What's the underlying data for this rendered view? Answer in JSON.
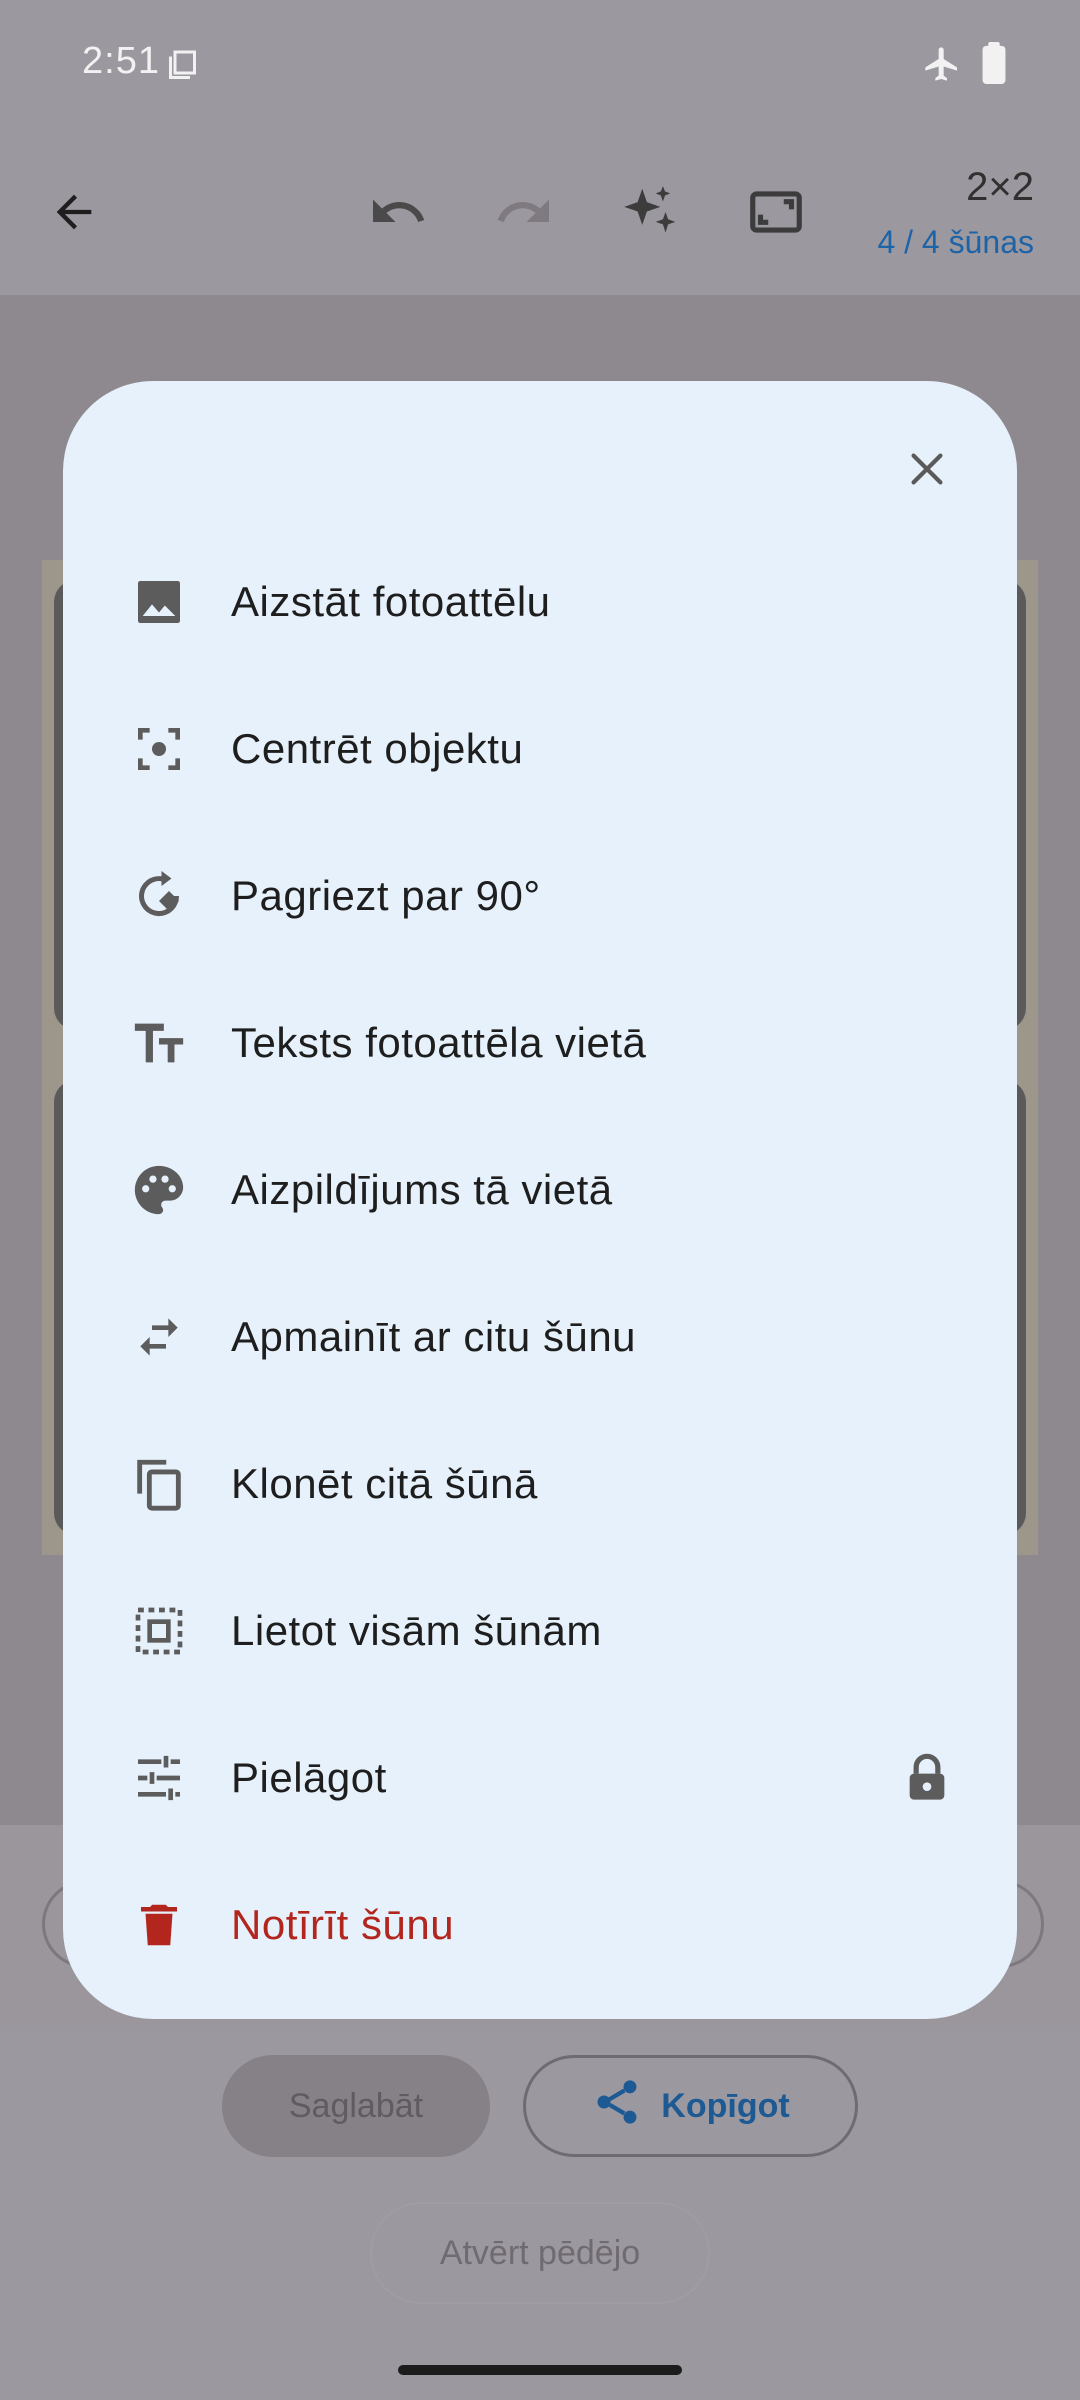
{
  "status_bar": {
    "time": "2:51"
  },
  "toolbar": {
    "grid_label": "2×2",
    "cell_count": "4 / 4 šūnas"
  },
  "dialog": {
    "items": [
      {
        "label": "Aizstāt fotoattēlu",
        "icon": "image-icon"
      },
      {
        "label": "Centrēt objektu",
        "icon": "center-focus-icon"
      },
      {
        "label": "Pagriezt par 90°",
        "icon": "rotate-icon"
      },
      {
        "label": "Teksts fotoattēla vietā",
        "icon": "text-fields-icon"
      },
      {
        "label": "Aizpildījums tā vietā",
        "icon": "palette-icon"
      },
      {
        "label": "Apmainīt ar citu šūnu",
        "icon": "swap-arrows-icon"
      },
      {
        "label": "Klonēt citā šūnā",
        "icon": "copy-icon"
      },
      {
        "label": "Lietot visām šūnām",
        "icon": "select-all-icon"
      },
      {
        "label": "Pielāgot",
        "icon": "tune-icon",
        "locked": true
      },
      {
        "label": "Notīrīt šūnu",
        "icon": "trash-icon",
        "danger": true
      }
    ]
  },
  "actions": {
    "save_label": "Saglabāt",
    "share_label": "Kopīgot",
    "open_last_label": "Atvērt pēdējo"
  },
  "colors": {
    "accent": "#1d63a8",
    "danger": "#b3261e",
    "dialog_bg": "#e6f1fb",
    "scrim": "#9c989f"
  }
}
